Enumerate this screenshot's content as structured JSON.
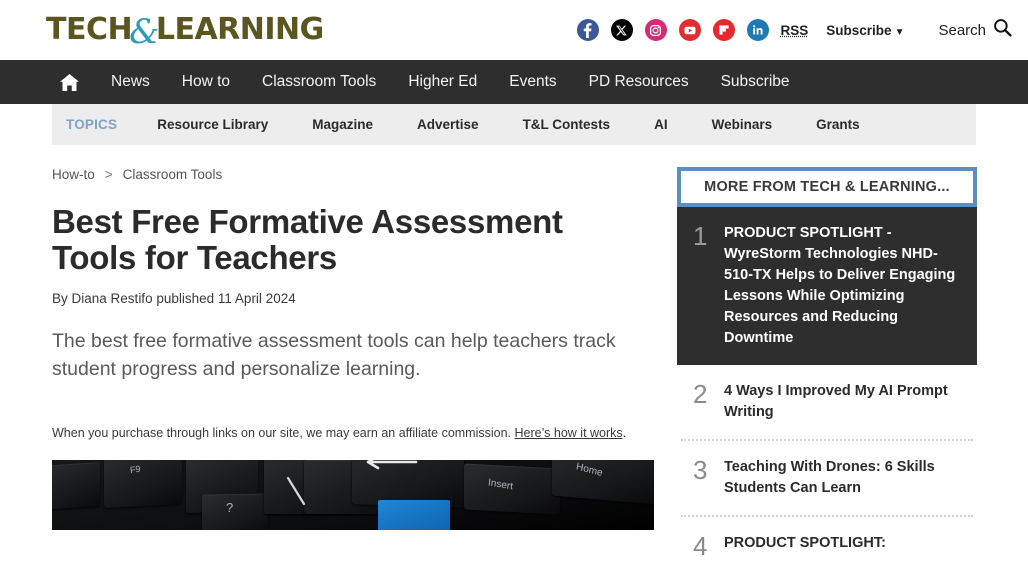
{
  "site": {
    "logo_part1": "TECH",
    "logo_amp": "&",
    "logo_part2": "LEARNING"
  },
  "header": {
    "socials": [
      {
        "name": "facebook-icon",
        "glyph": "f",
        "color": "#3b5998"
      },
      {
        "name": "x-twitter-icon",
        "glyph": "✕",
        "color": "#000000"
      },
      {
        "name": "instagram-icon",
        "glyph": "◎",
        "color": "#d62976"
      },
      {
        "name": "youtube-icon",
        "glyph": "▶",
        "color": "#e02f2f"
      },
      {
        "name": "flipboard-icon",
        "glyph": "■",
        "color": "#e8282c"
      },
      {
        "name": "linkedin-icon",
        "glyph": "in",
        "color": "#1c7bb5"
      }
    ],
    "rss_label": "RSS",
    "subscribe_label": "Subscribe",
    "subscribe_caret": "▼",
    "search_label": "Search",
    "search_icon": "search-icon"
  },
  "nav": {
    "home_icon": "home-icon",
    "items": [
      {
        "label": "News"
      },
      {
        "label": "How to"
      },
      {
        "label": "Classroom Tools"
      },
      {
        "label": "Higher Ed"
      },
      {
        "label": "Events"
      },
      {
        "label": "PD Resources"
      },
      {
        "label": "Subscribe"
      }
    ]
  },
  "topics_bar": {
    "label": "TOPICS",
    "items": [
      {
        "label": "Resource Library"
      },
      {
        "label": "Magazine"
      },
      {
        "label": "Advertise"
      },
      {
        "label": "T&L Contests"
      },
      {
        "label": "AI"
      },
      {
        "label": "Webinars"
      },
      {
        "label": "Grants"
      }
    ]
  },
  "article": {
    "breadcrumb": [
      {
        "label": "How-to"
      },
      {
        "label": "Classroom Tools"
      }
    ],
    "breadcrumb_separator": ">",
    "headline": "Best Free Formative Assessment Tools for Teachers",
    "byline_prefix": "By",
    "author": "Diana Restifo",
    "published_prefix": "published",
    "published_date": "11 April 2024",
    "standfirst": "The best free formative assessment tools can help teachers track student progress and personalize learning.",
    "affiliate_text": "When you purchase through links on our site, we may earn an affiliate commission.",
    "affiliate_link": "Here’s how it works",
    "affiliate_period": ".",
    "hero_image_alt": "keyboard-photo",
    "hero_keys": [
      "F9",
      "?",
      "Insert",
      "Home"
    ]
  },
  "rail": {
    "title": "MORE FROM TECH & LEARNING...",
    "items": [
      {
        "number": "1",
        "title": "PRODUCT SPOTLIGHT - WyreStorm Technologies NHD-510-TX Helps to Deliver Engaging Lessons While Optimizing Resources and Reducing Downtime",
        "active": true
      },
      {
        "number": "2",
        "title": "4 Ways I Improved My AI Prompt Writing",
        "active": false
      },
      {
        "number": "3",
        "title": "Teaching With Drones: 6 Skills Students Can Learn",
        "active": false
      },
      {
        "number": "4",
        "title": "PRODUCT SPOTLIGHT:",
        "active": false
      }
    ]
  },
  "colors": {
    "brand_olive": "#5b5520",
    "brand_teal": "#2e9bbd",
    "nav_dark": "#2e2e2e",
    "topics_bg": "#ededed",
    "topics_accent": "#7fa3c9",
    "rail_border": "#5b8fc4"
  }
}
